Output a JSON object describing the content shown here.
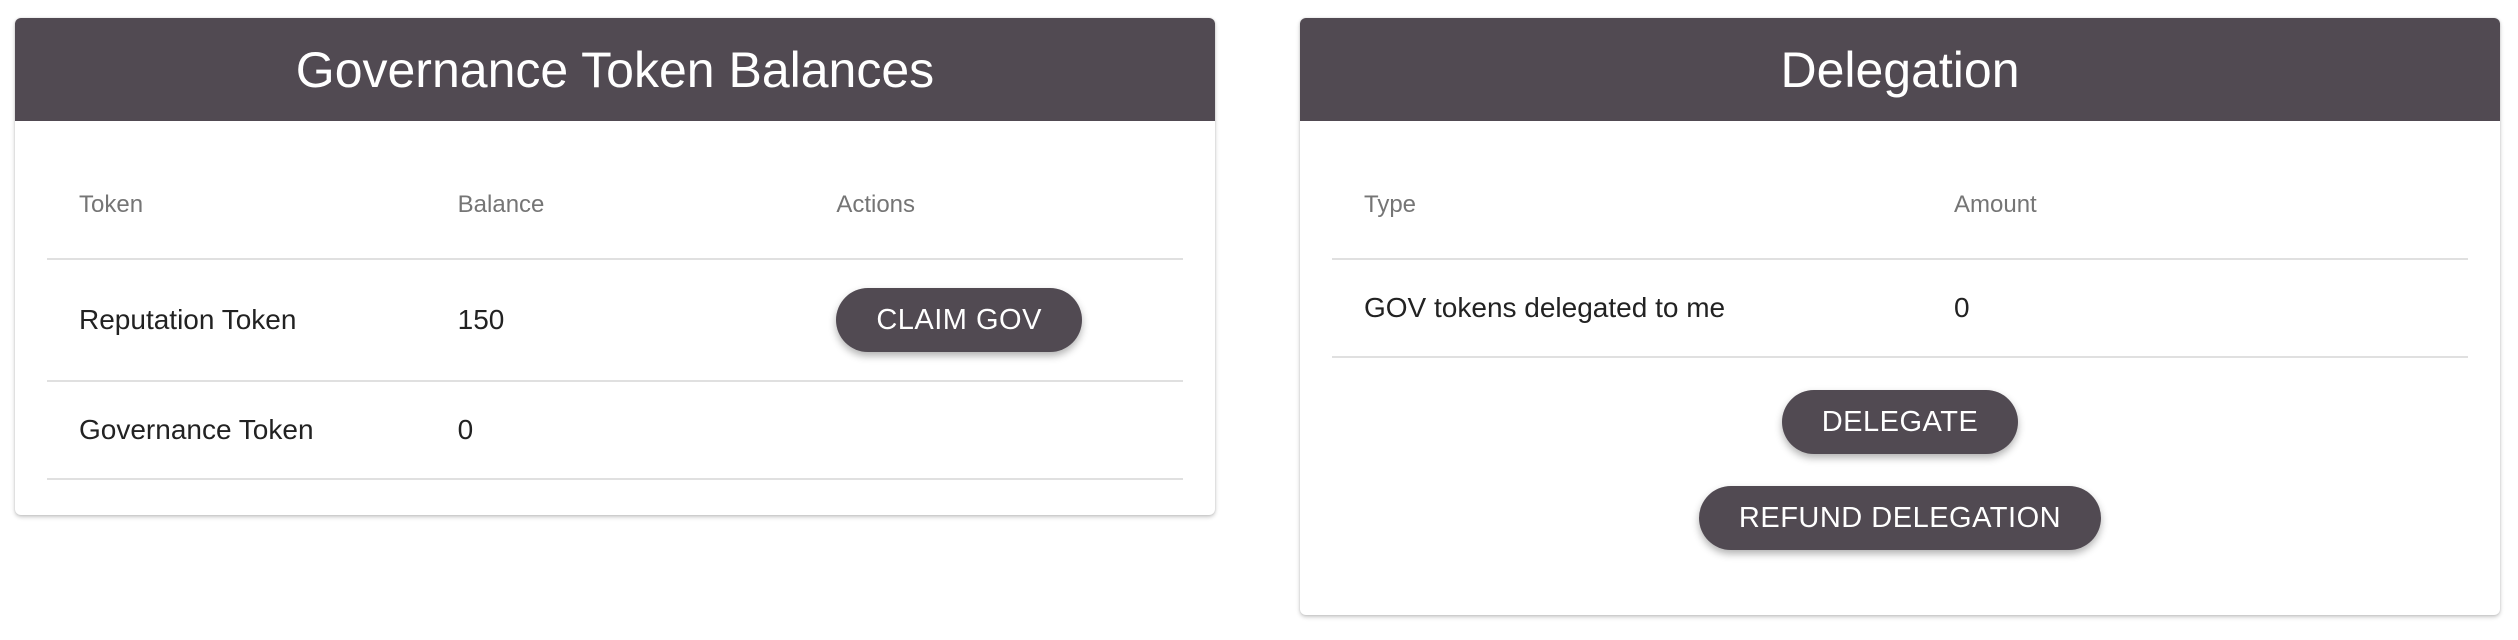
{
  "balances_card": {
    "title": "Governance Token Balances",
    "columns": [
      "Token",
      "Balance",
      "Actions"
    ],
    "rows": [
      {
        "token": "Reputation Token",
        "balance": "150",
        "action": "CLAIM GOV"
      },
      {
        "token": "Governance Token",
        "balance": "0",
        "action": ""
      }
    ]
  },
  "delegation_card": {
    "title": "Delegation",
    "columns": [
      "Type",
      "Amount"
    ],
    "rows": [
      {
        "type": "GOV tokens delegated to me",
        "amount": "0"
      }
    ],
    "delegate_label": "DELEGATE",
    "refund_label": "REFUND DELEGATION"
  },
  "colors": {
    "header_bg": "#514a52",
    "button_bg": "#514a52"
  }
}
